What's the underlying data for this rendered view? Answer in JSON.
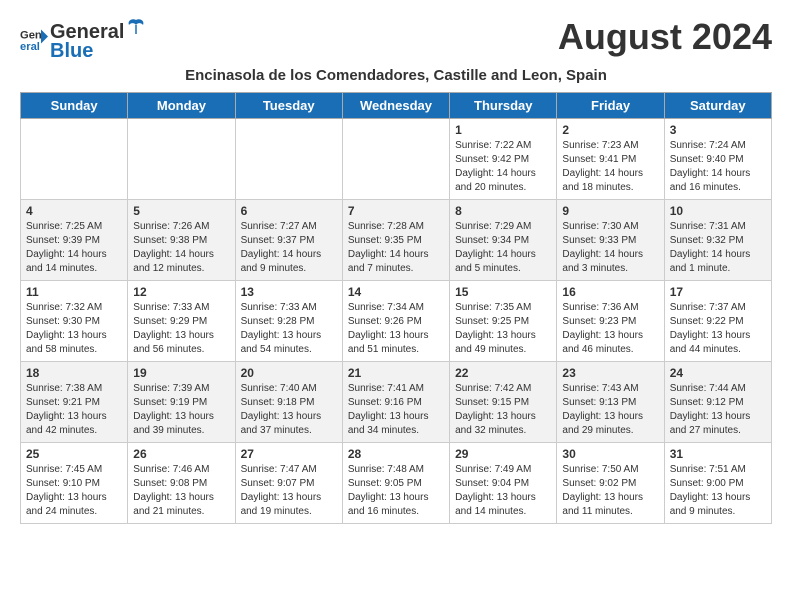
{
  "header": {
    "logo_general": "General",
    "logo_blue": "Blue",
    "month_year": "August 2024",
    "location": "Encinasola de los Comendadores, Castille and Leon, Spain"
  },
  "weekdays": [
    "Sunday",
    "Monday",
    "Tuesday",
    "Wednesday",
    "Thursday",
    "Friday",
    "Saturday"
  ],
  "weeks": [
    [
      {
        "day": "",
        "info": ""
      },
      {
        "day": "",
        "info": ""
      },
      {
        "day": "",
        "info": ""
      },
      {
        "day": "",
        "info": ""
      },
      {
        "day": "1",
        "info": "Sunrise: 7:22 AM\nSunset: 9:42 PM\nDaylight: 14 hours\nand 20 minutes."
      },
      {
        "day": "2",
        "info": "Sunrise: 7:23 AM\nSunset: 9:41 PM\nDaylight: 14 hours\nand 18 minutes."
      },
      {
        "day": "3",
        "info": "Sunrise: 7:24 AM\nSunset: 9:40 PM\nDaylight: 14 hours\nand 16 minutes."
      }
    ],
    [
      {
        "day": "4",
        "info": "Sunrise: 7:25 AM\nSunset: 9:39 PM\nDaylight: 14 hours\nand 14 minutes."
      },
      {
        "day": "5",
        "info": "Sunrise: 7:26 AM\nSunset: 9:38 PM\nDaylight: 14 hours\nand 12 minutes."
      },
      {
        "day": "6",
        "info": "Sunrise: 7:27 AM\nSunset: 9:37 PM\nDaylight: 14 hours\nand 9 minutes."
      },
      {
        "day": "7",
        "info": "Sunrise: 7:28 AM\nSunset: 9:35 PM\nDaylight: 14 hours\nand 7 minutes."
      },
      {
        "day": "8",
        "info": "Sunrise: 7:29 AM\nSunset: 9:34 PM\nDaylight: 14 hours\nand 5 minutes."
      },
      {
        "day": "9",
        "info": "Sunrise: 7:30 AM\nSunset: 9:33 PM\nDaylight: 14 hours\nand 3 minutes."
      },
      {
        "day": "10",
        "info": "Sunrise: 7:31 AM\nSunset: 9:32 PM\nDaylight: 14 hours\nand 1 minute."
      }
    ],
    [
      {
        "day": "11",
        "info": "Sunrise: 7:32 AM\nSunset: 9:30 PM\nDaylight: 13 hours\nand 58 minutes."
      },
      {
        "day": "12",
        "info": "Sunrise: 7:33 AM\nSunset: 9:29 PM\nDaylight: 13 hours\nand 56 minutes."
      },
      {
        "day": "13",
        "info": "Sunrise: 7:33 AM\nSunset: 9:28 PM\nDaylight: 13 hours\nand 54 minutes."
      },
      {
        "day": "14",
        "info": "Sunrise: 7:34 AM\nSunset: 9:26 PM\nDaylight: 13 hours\nand 51 minutes."
      },
      {
        "day": "15",
        "info": "Sunrise: 7:35 AM\nSunset: 9:25 PM\nDaylight: 13 hours\nand 49 minutes."
      },
      {
        "day": "16",
        "info": "Sunrise: 7:36 AM\nSunset: 9:23 PM\nDaylight: 13 hours\nand 46 minutes."
      },
      {
        "day": "17",
        "info": "Sunrise: 7:37 AM\nSunset: 9:22 PM\nDaylight: 13 hours\nand 44 minutes."
      }
    ],
    [
      {
        "day": "18",
        "info": "Sunrise: 7:38 AM\nSunset: 9:21 PM\nDaylight: 13 hours\nand 42 minutes."
      },
      {
        "day": "19",
        "info": "Sunrise: 7:39 AM\nSunset: 9:19 PM\nDaylight: 13 hours\nand 39 minutes."
      },
      {
        "day": "20",
        "info": "Sunrise: 7:40 AM\nSunset: 9:18 PM\nDaylight: 13 hours\nand 37 minutes."
      },
      {
        "day": "21",
        "info": "Sunrise: 7:41 AM\nSunset: 9:16 PM\nDaylight: 13 hours\nand 34 minutes."
      },
      {
        "day": "22",
        "info": "Sunrise: 7:42 AM\nSunset: 9:15 PM\nDaylight: 13 hours\nand 32 minutes."
      },
      {
        "day": "23",
        "info": "Sunrise: 7:43 AM\nSunset: 9:13 PM\nDaylight: 13 hours\nand 29 minutes."
      },
      {
        "day": "24",
        "info": "Sunrise: 7:44 AM\nSunset: 9:12 PM\nDaylight: 13 hours\nand 27 minutes."
      }
    ],
    [
      {
        "day": "25",
        "info": "Sunrise: 7:45 AM\nSunset: 9:10 PM\nDaylight: 13 hours\nand 24 minutes."
      },
      {
        "day": "26",
        "info": "Sunrise: 7:46 AM\nSunset: 9:08 PM\nDaylight: 13 hours\nand 21 minutes."
      },
      {
        "day": "27",
        "info": "Sunrise: 7:47 AM\nSunset: 9:07 PM\nDaylight: 13 hours\nand 19 minutes."
      },
      {
        "day": "28",
        "info": "Sunrise: 7:48 AM\nSunset: 9:05 PM\nDaylight: 13 hours\nand 16 minutes."
      },
      {
        "day": "29",
        "info": "Sunrise: 7:49 AM\nSunset: 9:04 PM\nDaylight: 13 hours\nand 14 minutes."
      },
      {
        "day": "30",
        "info": "Sunrise: 7:50 AM\nSunset: 9:02 PM\nDaylight: 13 hours\nand 11 minutes."
      },
      {
        "day": "31",
        "info": "Sunrise: 7:51 AM\nSunset: 9:00 PM\nDaylight: 13 hours\nand 9 minutes."
      }
    ]
  ]
}
